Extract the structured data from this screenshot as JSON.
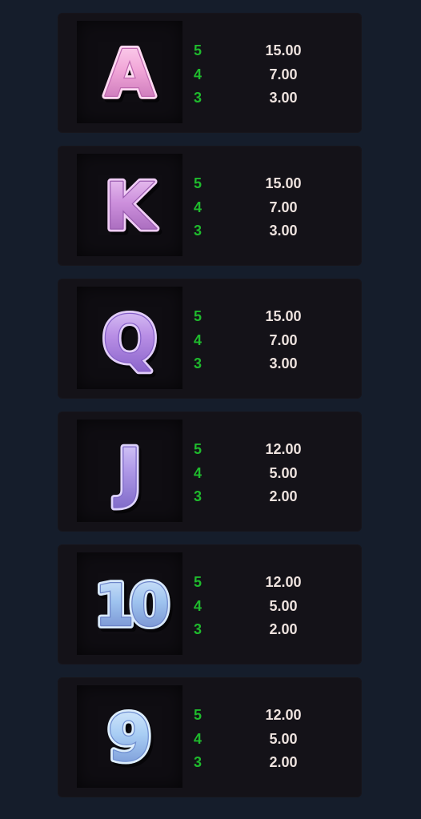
{
  "paytable": {
    "symbols": [
      {
        "id": "a",
        "glyph": "A",
        "color_main": "#f1a6d8",
        "color_dark": "#bf69b0",
        "color_light": "#ffd9f1",
        "payouts": [
          {
            "count": "5",
            "value": "15.00"
          },
          {
            "count": "4",
            "value": "7.00"
          },
          {
            "count": "3",
            "value": "3.00"
          }
        ]
      },
      {
        "id": "k",
        "glyph": "K",
        "color_main": "#cc8fdc",
        "color_dark": "#9a5cb0",
        "color_light": "#f0cdf5",
        "payouts": [
          {
            "count": "5",
            "value": "15.00"
          },
          {
            "count": "4",
            "value": "7.00"
          },
          {
            "count": "3",
            "value": "3.00"
          }
        ]
      },
      {
        "id": "q",
        "glyph": "Q",
        "color_main": "#b88ee5",
        "color_dark": "#8660c8",
        "color_light": "#e1cdf8",
        "payouts": [
          {
            "count": "5",
            "value": "15.00"
          },
          {
            "count": "4",
            "value": "7.00"
          },
          {
            "count": "3",
            "value": "3.00"
          }
        ]
      },
      {
        "id": "j",
        "glyph": "J",
        "color_main": "#b19be9",
        "color_dark": "#7f6ac8",
        "color_light": "#ddd3fb",
        "payouts": [
          {
            "count": "5",
            "value": "12.00"
          },
          {
            "count": "4",
            "value": "5.00"
          },
          {
            "count": "3",
            "value": "2.00"
          }
        ]
      },
      {
        "id": "10",
        "glyph": "10",
        "color_main": "#9ec3ef",
        "color_dark": "#6d85c9",
        "color_light": "#d7e8fb",
        "payouts": [
          {
            "count": "5",
            "value": "12.00"
          },
          {
            "count": "4",
            "value": "5.00"
          },
          {
            "count": "3",
            "value": "2.00"
          }
        ]
      },
      {
        "id": "9",
        "glyph": "9",
        "color_main": "#a8cdf4",
        "color_dark": "#6f8ed0",
        "color_light": "#ddeefc",
        "payouts": [
          {
            "count": "5",
            "value": "12.00"
          },
          {
            "count": "4",
            "value": "5.00"
          },
          {
            "count": "3",
            "value": "2.00"
          }
        ]
      }
    ]
  }
}
